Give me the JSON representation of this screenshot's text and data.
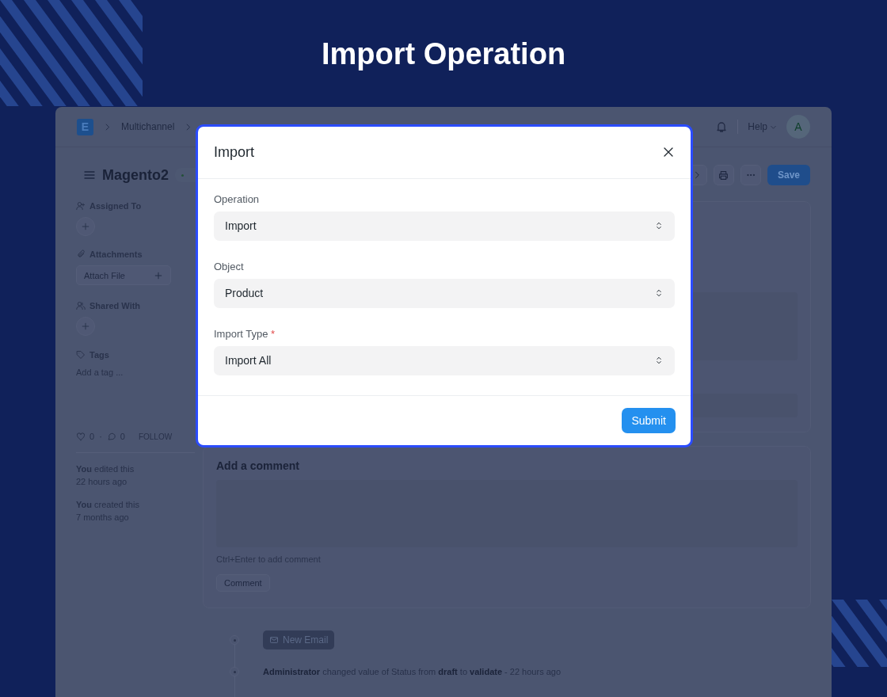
{
  "page_title": "Import Operation",
  "app": {
    "logo": "E",
    "breadcrumb": [
      "Multichannel"
    ],
    "help": "Help",
    "avatar": "A",
    "doc": {
      "title": "Magento2",
      "save": "Save"
    },
    "sidebar": {
      "assigned_to": "Assigned To",
      "attachments": "Attachments",
      "attach_file": "Attach File",
      "shared_with": "Shared With",
      "tags": "Tags",
      "tag_placeholder": "Add a tag ...",
      "likes": "0",
      "separator": "·",
      "comments": "0",
      "follow": "FOLLOW",
      "activity": [
        {
          "text": "**You** edited this",
          "time": "22 hours ago"
        },
        {
          "text": "**You** created this",
          "time": "7 months ago"
        }
      ]
    },
    "comment_box": {
      "title": "Add a comment",
      "hint": "Ctrl+Enter to add comment",
      "button": "Comment"
    },
    "timeline": {
      "new_email": "New Email",
      "entries": [
        "**Administrator** changed value of Status from **draft** to **validate** - 22 hours ago"
      ]
    }
  },
  "dialog": {
    "title": "Import",
    "fields": [
      {
        "label": "Operation",
        "value": "Import"
      },
      {
        "label": "Object",
        "value": "Product"
      },
      {
        "label": "Import Type",
        "required_mark": "*",
        "value": "Import All"
      }
    ],
    "submit": "Submit"
  }
}
